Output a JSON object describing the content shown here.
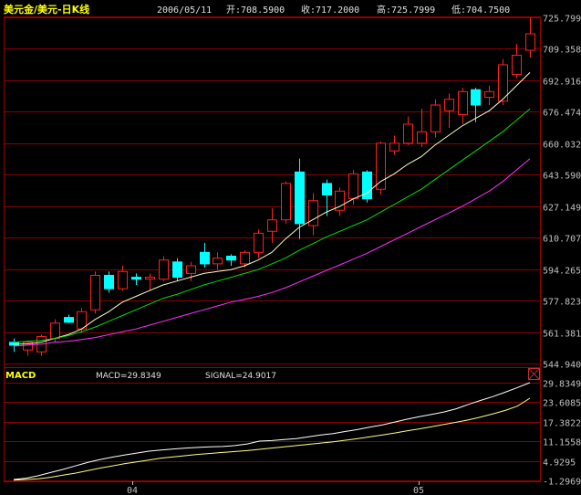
{
  "header": {
    "title": "美元金/美元-日K线",
    "date": "2006/05/11",
    "open": "开:708.5900",
    "close": "收:717.2000",
    "high": "高:725.7999",
    "low": "低:704.7500"
  },
  "macd_panel": {
    "label": "MACD",
    "macd_text": "MACD=29.8349",
    "signal_text": "SIGNAL=24.9017"
  },
  "colors": {
    "up": "#ff2020",
    "down": "#00ffff",
    "grid": "#8b0000",
    "ma_short": "#ffffc0",
    "ma_mid": "#00e000",
    "ma_long": "#ff30ff",
    "macd_line": "#ffffff",
    "signal_line": "#ffff80",
    "title": "#ffff00",
    "axis_text": "#c0c0c0"
  },
  "chart_data": [
    {
      "type": "candlestick",
      "ylim": [
        544.94,
        725.7999
      ],
      "y_ticks": [
        "725.7999",
        "709.3588",
        "692.9163",
        "676.4748",
        "660.0327",
        "643.5905",
        "627.1490",
        "610.7075",
        "594.2654",
        "577.8239",
        "561.3818",
        "544.9403"
      ],
      "candles": [
        {
          "o": 556.0,
          "h": 558.0,
          "l": 551.0,
          "c": 554.5
        },
        {
          "o": 552.0,
          "h": 557.0,
          "l": 549.0,
          "c": 556.0
        },
        {
          "o": 551.0,
          "h": 560.0,
          "l": 549.0,
          "c": 559.0
        },
        {
          "o": 558.0,
          "h": 568.0,
          "l": 556.0,
          "c": 566.0
        },
        {
          "o": 569.0,
          "h": 570.5,
          "l": 566.0,
          "c": 566.5
        },
        {
          "o": 563.0,
          "h": 574.0,
          "l": 561.0,
          "c": 572.0
        },
        {
          "o": 573.0,
          "h": 593.0,
          "l": 571.0,
          "c": 591.0
        },
        {
          "o": 591.0,
          "h": 593.0,
          "l": 582.0,
          "c": 584.0
        },
        {
          "o": 584.0,
          "h": 596.0,
          "l": 583.0,
          "c": 593.0
        },
        {
          "o": 590.0,
          "h": 592.0,
          "l": 586.0,
          "c": 589.0
        },
        {
          "o": 589.0,
          "h": 592.0,
          "l": 583.0,
          "c": 590.0
        },
        {
          "o": 589.0,
          "h": 601.0,
          "l": 588.0,
          "c": 599.0
        },
        {
          "o": 598.0,
          "h": 600.0,
          "l": 588.0,
          "c": 590.0
        },
        {
          "o": 592.0,
          "h": 598.0,
          "l": 588.0,
          "c": 596.0
        },
        {
          "o": 603.0,
          "h": 608.0,
          "l": 595.0,
          "c": 597.0
        },
        {
          "o": 597.0,
          "h": 603.0,
          "l": 594.0,
          "c": 600.0
        },
        {
          "o": 601.0,
          "h": 602.0,
          "l": 596.0,
          "c": 599.0
        },
        {
          "o": 597.0,
          "h": 604.0,
          "l": 595.0,
          "c": 603.0
        },
        {
          "o": 603.0,
          "h": 615.0,
          "l": 600.0,
          "c": 613.0
        },
        {
          "o": 614.0,
          "h": 626.0,
          "l": 608.0,
          "c": 620.0
        },
        {
          "o": 620.0,
          "h": 640.0,
          "l": 618.0,
          "c": 639.0
        },
        {
          "o": 645.0,
          "h": 652.0,
          "l": 610.0,
          "c": 618.0
        },
        {
          "o": 617.0,
          "h": 634.0,
          "l": 612.0,
          "c": 630.0
        },
        {
          "o": 639.0,
          "h": 641.0,
          "l": 622.0,
          "c": 633.0
        },
        {
          "o": 625.0,
          "h": 637.0,
          "l": 622.0,
          "c": 635.0
        },
        {
          "o": 631.0,
          "h": 646.0,
          "l": 628.0,
          "c": 644.0
        },
        {
          "o": 645.0,
          "h": 646.0,
          "l": 629.0,
          "c": 631.0
        },
        {
          "o": 636.0,
          "h": 661.0,
          "l": 633.0,
          "c": 660.0
        },
        {
          "o": 656.0,
          "h": 664.0,
          "l": 654.0,
          "c": 660.0
        },
        {
          "o": 660.0,
          "h": 674.0,
          "l": 659.0,
          "c": 670.0
        },
        {
          "o": 660.0,
          "h": 678.0,
          "l": 658.0,
          "c": 666.0
        },
        {
          "o": 666.0,
          "h": 683.0,
          "l": 663.0,
          "c": 680.0
        },
        {
          "o": 677.0,
          "h": 686.0,
          "l": 668.0,
          "c": 683.0
        },
        {
          "o": 675.0,
          "h": 689.0,
          "l": 670.0,
          "c": 687.0
        },
        {
          "o": 688.0,
          "h": 689.0,
          "l": 671.0,
          "c": 680.0
        },
        {
          "o": 684.0,
          "h": 690.0,
          "l": 680.0,
          "c": 687.0
        },
        {
          "o": 682.0,
          "h": 704.0,
          "l": 680.0,
          "c": 701.0
        },
        {
          "o": 696.0,
          "h": 712.0,
          "l": 694.0,
          "c": 706.0
        },
        {
          "o": 708.59,
          "h": 725.7999,
          "l": 704.75,
          "c": 717.2
        }
      ],
      "ma_short": [
        555.0,
        555.2,
        556.0,
        558.0,
        560.0,
        563.0,
        568.0,
        572.0,
        577.0,
        580.0,
        583.0,
        586.0,
        588.0,
        590.0,
        592.0,
        593.0,
        594.0,
        596.0,
        599.0,
        603.0,
        610.0,
        616.0,
        620.0,
        624.0,
        627.0,
        631.0,
        634.0,
        640.0,
        644.0,
        649.0,
        653.0,
        659.0,
        664.0,
        669.0,
        673.0,
        677.0,
        683.0,
        690.0,
        697.0
      ],
      "ma_mid": [
        556.0,
        556.5,
        557.0,
        558.0,
        559.5,
        561.5,
        564.0,
        567.0,
        570.0,
        573.0,
        576.0,
        579.0,
        581.0,
        583.5,
        586.0,
        588.0,
        590.0,
        592.0,
        594.0,
        597.0,
        600.0,
        604.0,
        607.5,
        611.0,
        614.0,
        617.0,
        620.0,
        624.0,
        628.0,
        632.0,
        636.0,
        641.0,
        646.0,
        651.0,
        656.0,
        661.0,
        666.0,
        672.0,
        678.0
      ],
      "ma_long": [
        554.0,
        554.5,
        555.0,
        556.0,
        556.5,
        557.5,
        558.5,
        560.0,
        561.5,
        563.0,
        565.0,
        567.0,
        569.0,
        571.0,
        573.0,
        575.0,
        577.0,
        578.5,
        580.0,
        582.0,
        584.5,
        587.5,
        590.5,
        593.5,
        596.5,
        599.5,
        602.5,
        606.0,
        609.5,
        613.0,
        616.5,
        620.0,
        623.5,
        627.0,
        631.0,
        635.0,
        640.0,
        646.0,
        652.0
      ]
    },
    {
      "type": "line",
      "ylim": [
        -1.2969,
        29.8349
      ],
      "y_ticks": [
        "29.8349",
        "23.6085",
        "17.3822",
        "11.1558",
        "4.9295",
        "-1.2969"
      ],
      "x_tick_labels": [
        "04",
        "05"
      ],
      "series": [
        {
          "name": "MACD",
          "values": [
            -1.0,
            -0.6,
            0.2,
            1.2,
            2.2,
            3.3,
            4.4,
            5.3,
            6.1,
            6.8,
            7.4,
            8.0,
            8.4,
            8.7,
            9.0,
            9.2,
            9.4,
            9.5,
            9.8,
            10.3,
            11.2,
            11.4,
            11.7,
            12.0,
            12.6,
            13.2,
            13.6,
            14.3,
            14.9,
            15.7,
            16.4,
            17.3,
            18.2,
            19.0,
            19.7,
            20.5,
            21.5,
            22.9,
            24.2,
            25.4,
            26.8,
            28.3,
            29.83
          ]
        },
        {
          "name": "SIGNAL",
          "values": [
            -1.2,
            -1.0,
            -0.8,
            -0.3,
            0.4,
            1.0,
            1.8,
            2.6,
            3.3,
            4.0,
            4.6,
            5.2,
            5.8,
            6.2,
            6.6,
            7.0,
            7.3,
            7.6,
            7.9,
            8.2,
            8.6,
            9.0,
            9.4,
            9.8,
            10.2,
            10.6,
            11.0,
            11.5,
            12.0,
            12.6,
            13.2,
            13.8,
            14.5,
            15.1,
            15.8,
            16.5,
            17.2,
            18.0,
            18.9,
            19.9,
            21.0,
            22.4,
            24.9
          ]
        }
      ]
    }
  ]
}
